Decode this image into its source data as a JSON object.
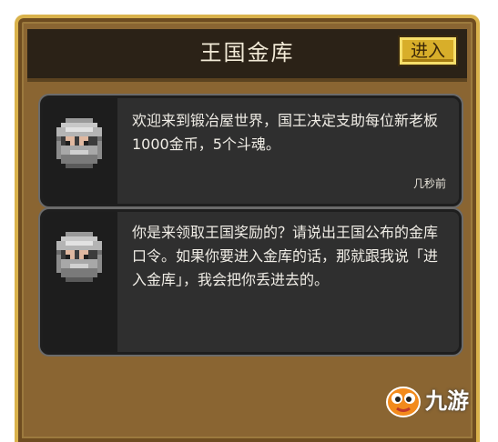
{
  "header": {
    "title": "王国金库",
    "enter_button": "进入"
  },
  "messages": [
    {
      "avatar_icon": "knight-helmet-icon",
      "text": "欢迎来到锻冶屋世界，国王决定支助每位新老板1000金币，5个斗魂。",
      "time": "几秒前"
    },
    {
      "avatar_icon": "knight-helmet-icon",
      "text": "你是来领取王国奖励的？请说出王国公布的金库口令。如果你要进入金库的话，那就跟我说「进入金库」，我会把你丢进去的。"
    }
  ],
  "watermark": {
    "text": "九游"
  },
  "colors": {
    "frame_gold": "#d9b24c",
    "panel_brown": "#8a6532",
    "titlebar": "#2b2217",
    "button_gold": "#d8ae2a",
    "card_bg": "#2f2f2f",
    "watermark_orange": "#f28a1c"
  }
}
